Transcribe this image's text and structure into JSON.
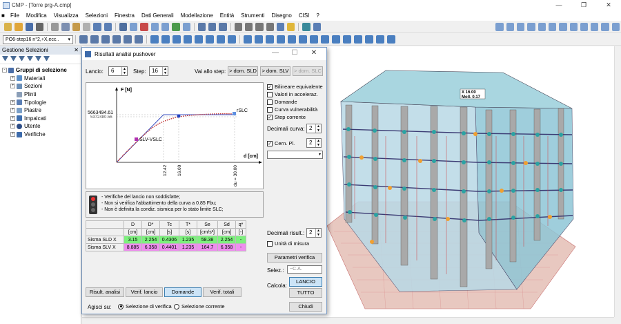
{
  "app": {
    "title": "CMP - [Torre prg-A.cmp]"
  },
  "menu": [
    "File",
    "Modifica",
    "Visualizza",
    "Selezioni",
    "Finestra",
    "Dati Generali",
    "Modellazione",
    "Entità",
    "Strumenti",
    "Disegno",
    "CISI",
    "?"
  ],
  "toolbar": {
    "step_combo": "PO6-step16 n°2,+X,ecc.."
  },
  "left_panel": {
    "title": "Gestione Selezioni",
    "root": "Gruppi di selezione",
    "items": [
      "Materiali",
      "Sezioni",
      "Plinti",
      "Tipologie",
      "Piastre",
      "Impalcati",
      "Utente",
      "Verifiche"
    ]
  },
  "dialog": {
    "title": "Risultati analisi pushover",
    "lancio_label": "Lancio:",
    "lancio_value": "6",
    "step_label": "Step:",
    "step_value": "16",
    "vai_label": "Vai allo step:",
    "btn_slo": "> dom. SLD",
    "btn_slv": "> dom. SLV",
    "btn_slc": "> dom. SLC",
    "plot": {
      "ylabel": "F [N]",
      "xlabel": "d [cm]",
      "y_tick": "5663494.61",
      "y_tick2": "5372480.56",
      "x_tick1": "12.42",
      "x_tick2": "16.00",
      "x_tick3": "du = 30.00",
      "label_slc": "rSLC",
      "label_slv": "SLV-VSLC"
    },
    "checks": {
      "bilineare": "Bilineare equivalente",
      "acceleraz": "Valori in acceleraz.",
      "domande": "Domande",
      "curva": "Curva vulnerabilità",
      "step_corr": "Step corrente"
    },
    "decimali_curva_label": "Decimali curva:",
    "decimali_curva": "2",
    "cern_label": "Cern. Pl.",
    "cern_value": "2",
    "messages": [
      "- Verifiche del lancio non soddisfatte;",
      "- Non si verifica l'abbattimento della curva a 0.85 Fbu;",
      "- Non è definita la condiz. sismica per lo stato limite SLC;"
    ],
    "table": {
      "headers": [
        "D",
        "D*",
        "Tc",
        "T*",
        "Se",
        "Sd",
        "q*"
      ],
      "units": [
        "[cm]",
        "[cm]",
        "[s]",
        "[s]",
        "[cm/s²]",
        "[cm]",
        "[-]"
      ],
      "rows": [
        {
          "name": "Sisma SLD X",
          "values": [
            "3.15",
            "2.254",
            "0.4306",
            "1.235",
            "58.38",
            "2.254",
            "-"
          ]
        },
        {
          "name": "Sisma SLV X",
          "values": [
            "8.885",
            "6.358",
            "0.4401",
            "1.235",
            "164.7",
            "6.358",
            "-"
          ]
        }
      ]
    },
    "decimali_risult_label": "Decimali risult.:",
    "decimali_risult": "2",
    "unita_misura": "Unità di misura",
    "param_verifica": "Parametri verifica",
    "selez_label": "Selez.:",
    "selez_value": "~C.A.",
    "calcola_label": "Calcola:",
    "btn_lancio": "LANCIO",
    "btn_tutto": "TUTTO",
    "tabs": [
      "Risult. analisi",
      "Verif. lancio",
      "Domande",
      "Verif. totali"
    ],
    "agisci_label": "Agisci su:",
    "radio1": "Selezione di verifica",
    "radio2": "Selezione corrente",
    "btn_chiudi": "Chiudi"
  },
  "model": {
    "label1": "X 16.00",
    "label2": "Moll. 0.17"
  }
}
